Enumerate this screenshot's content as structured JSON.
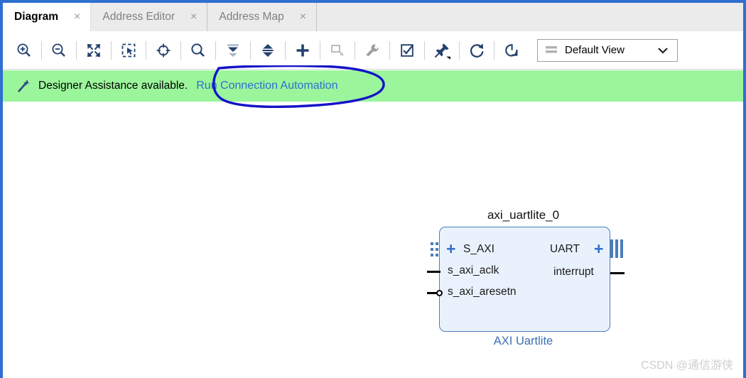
{
  "window": {
    "accent_color": "#2f6fd0"
  },
  "tabs": [
    {
      "label": "Diagram",
      "close": "×",
      "active": true
    },
    {
      "label": "Address Editor",
      "close": "×",
      "active": false
    },
    {
      "label": "Address Map",
      "close": "×",
      "active": false
    }
  ],
  "toolbar": {
    "buttons": [
      {
        "name": "zoom-in-icon",
        "title": "Zoom In",
        "enabled": true
      },
      {
        "name": "zoom-out-icon",
        "title": "Zoom Out",
        "enabled": true
      },
      {
        "name": "zoom-fit-icon",
        "title": "Zoom Fit",
        "enabled": true
      },
      {
        "name": "zoom-to-selection-icon",
        "title": "Zoom To Selection",
        "enabled": true
      },
      {
        "name": "locate-crosshair-icon",
        "title": "Locate",
        "enabled": true
      },
      {
        "name": "search-icon",
        "title": "Search",
        "enabled": true
      },
      {
        "name": "collapse-all-icon",
        "title": "Collapse All",
        "enabled": true
      },
      {
        "name": "expand-all-icon",
        "title": "Expand All",
        "enabled": true
      },
      {
        "name": "add-ip-icon",
        "title": "Add IP",
        "enabled": true
      },
      {
        "name": "add-module-icon",
        "title": "Add Module",
        "enabled": false
      },
      {
        "name": "settings-wrench-icon",
        "title": "Settings",
        "enabled": false
      },
      {
        "name": "validate-design-icon",
        "title": "Validate Design",
        "enabled": true
      },
      {
        "name": "pin-icon",
        "title": "Pin",
        "enabled": true
      },
      {
        "name": "refresh-icon",
        "title": "Refresh",
        "enabled": true
      },
      {
        "name": "regenerate-layout-icon",
        "title": "Regenerate Layout",
        "enabled": true
      }
    ],
    "view_select": {
      "label": "Default View",
      "chevron": "chevron-down-icon",
      "menu_icon": "layers-icon"
    }
  },
  "banner": {
    "icon": "magic-wand-icon",
    "message": "Designer Assistance available.",
    "link": "Run Connection Automation",
    "background": "#9bf59b",
    "link_color": "#2f6fd0"
  },
  "annotation": {
    "shape": "hand-drawn-ellipse",
    "color": "#1414c8",
    "targets": "Run Connection Automation"
  },
  "diagram": {
    "block": {
      "title": "axi_uartlite_0",
      "caption": "AXI Uartlite",
      "fill": "#e9f2fc",
      "border": "#4a7ebb",
      "left_ports": [
        {
          "label": "S_AXI",
          "type": "bus",
          "expander": "+"
        },
        {
          "label": "s_axi_aclk",
          "type": "clock"
        },
        {
          "label": "s_axi_aresetn",
          "type": "reset-active-low"
        }
      ],
      "right_ports": [
        {
          "label": "UART",
          "type": "bus",
          "expander": "+"
        },
        {
          "label": "interrupt",
          "type": "signal"
        }
      ]
    }
  },
  "watermark": {
    "text": "CSDN @通信游侠"
  }
}
